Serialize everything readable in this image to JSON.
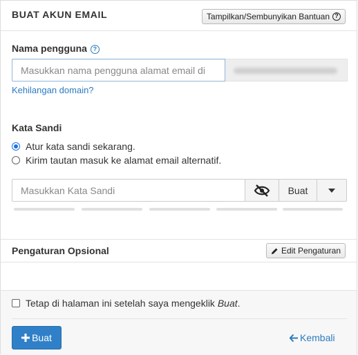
{
  "header": {
    "title": "BUAT AKUN EMAIL",
    "help_toggle_label": "Tampilkan/Sembunyikan Bantuan"
  },
  "username": {
    "label": "Nama pengguna",
    "placeholder": "Masukkan nama pengguna alamat email di",
    "value": "",
    "lost_domain_link": "Kehilangan domain?"
  },
  "password": {
    "label": "Kata Sandi",
    "options": [
      {
        "label": "Atur kata sandi sekarang.",
        "checked": true
      },
      {
        "label": "Kirim tautan masuk ke alamat email alternatif.",
        "checked": false
      }
    ],
    "placeholder": "Masukkan Kata Sandi",
    "value": "",
    "generate_label": "Buat",
    "visibility_icon": "eye-slash-icon",
    "dropdown_icon": "caret-down-icon"
  },
  "optional_settings": {
    "title": "Pengaturan Opsional",
    "edit_label": "Edit Pengaturan",
    "edit_icon": "pencil-icon"
  },
  "footer": {
    "stay_label_prefix": "Tetap di halaman ini setelah saya mengeklik ",
    "stay_label_emph": "Buat",
    "stay_label_suffix": ".",
    "stay_checked": false,
    "create_label": "Buat",
    "create_icon": "plus-icon",
    "back_label": "Kembali",
    "back_icon": "arrow-left-icon"
  },
  "colors": {
    "primary": "#2f80c8",
    "link": "#2a7bbf"
  }
}
